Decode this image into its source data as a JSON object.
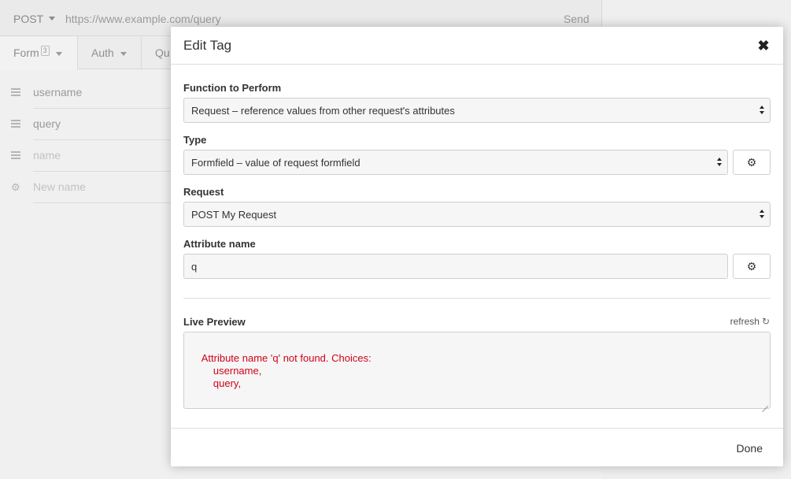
{
  "background": {
    "method": "POST",
    "url": "https://www.example.com/query",
    "send_label": "Send",
    "tabs": [
      {
        "label": "Form",
        "badge": "3"
      },
      {
        "label": "Auth"
      },
      {
        "label": "Qu"
      }
    ],
    "params": [
      {
        "name": "username",
        "placeholder": false
      },
      {
        "name": "query",
        "placeholder": false
      },
      {
        "name": "name",
        "placeholder": true
      },
      {
        "name": "New name",
        "placeholder": true
      }
    ]
  },
  "modal": {
    "title": "Edit Tag",
    "close_icon": "close-icon",
    "function_label": "Function to Perform",
    "function_value": "Request – reference values from other request's attributes",
    "type_label": "Type",
    "type_value": "Formfield – value of request formfield",
    "request_label": "Request",
    "request_value": "POST My Request",
    "attribute_label": "Attribute name",
    "attribute_value": "q",
    "preview_label": "Live Preview",
    "refresh_label": "refresh",
    "preview_text": "Attribute name 'q' not found. Choices:\n\tusername,\n\tquery,",
    "done_label": "Done"
  },
  "colors": {
    "error": "#d0021b"
  }
}
